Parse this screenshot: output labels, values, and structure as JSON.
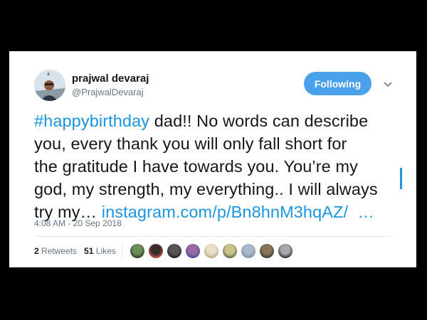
{
  "user": {
    "name": "prajwal devaraj",
    "handle": "@PrajwalDevaraj"
  },
  "follow_button": {
    "label": "Following",
    "color": "#4aa1eb"
  },
  "tweet": {
    "hashtag": "#happybirthday",
    "line1_rest": " dad!! No words can describe",
    "line2": "you, every thank you will only fall short for",
    "line3": "the gratitude I have towards you. You’re my",
    "line4": "god, my strength, my everything.. I will always",
    "line5_start": "try my… ",
    "link": "instagram.com/p/Bn8hnM3hqAZ/",
    "link_tail": "  …",
    "link_color": "#1b95e0"
  },
  "timestamp": "4:08 AM - 20 Sep 2018",
  "stats": {
    "retweets_count": "2",
    "retweets_label": "Retweets",
    "likes_count": "51",
    "likes_label": "Likes"
  },
  "likers": [
    {
      "name": "liker-avatar-1",
      "colors": [
        "#6b8f5a",
        "#2d3b2a"
      ]
    },
    {
      "name": "liker-avatar-2",
      "colors": [
        "#3a2a2a",
        "#c0504d"
      ]
    },
    {
      "name": "liker-avatar-3",
      "colors": [
        "#555",
        "#222"
      ]
    },
    {
      "name": "liker-avatar-4",
      "colors": [
        "#9d6aa0",
        "#3b4f9e"
      ]
    },
    {
      "name": "liker-avatar-5",
      "colors": [
        "#e8e0c8",
        "#b9a77c"
      ]
    },
    {
      "name": "liker-avatar-6",
      "colors": [
        "#c9c48a",
        "#5d6b3d"
      ]
    },
    {
      "name": "liker-avatar-7",
      "colors": [
        "#a9b8cc",
        "#7f8fa6"
      ]
    },
    {
      "name": "liker-avatar-8",
      "colors": [
        "#8a7458",
        "#3f3a30"
      ]
    },
    {
      "name": "liker-avatar-9",
      "colors": [
        "#a8a8a8",
        "#2f2f2f"
      ]
    }
  ]
}
